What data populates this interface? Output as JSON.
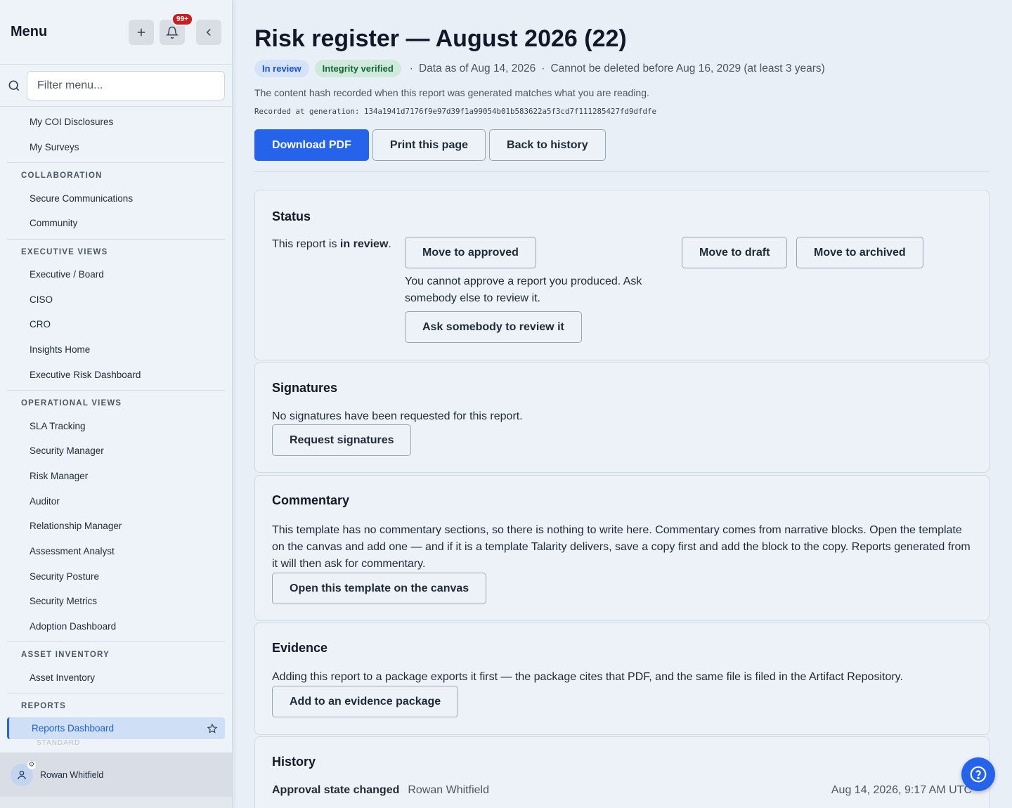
{
  "sidebar": {
    "title": "Menu",
    "notification_badge": "99+",
    "filter_placeholder": "Filter menu...",
    "top_items": [
      "My COI Disclosures",
      "My Surveys"
    ],
    "sections": [
      {
        "title": "COLLABORATION",
        "items": [
          "Secure Communications",
          "Community"
        ]
      },
      {
        "title": "EXECUTIVE VIEWS",
        "items": [
          "Executive / Board",
          "CISO",
          "CRO",
          "Insights Home",
          "Executive Risk Dashboard"
        ]
      },
      {
        "title": "OPERATIONAL VIEWS",
        "items": [
          "SLA Tracking",
          "Security Manager",
          "Risk Manager",
          "Auditor",
          "Relationship Manager",
          "Assessment Analyst",
          "Security Posture",
          "Security Metrics",
          "Adoption Dashboard"
        ]
      },
      {
        "title": "ASSET INVENTORY",
        "items": [
          "Asset Inventory"
        ]
      },
      {
        "title": "REPORTS",
        "items": [
          "Reports Dashboard"
        ]
      }
    ],
    "active_item": "Reports Dashboard",
    "faded_label": "STANDARD",
    "user_name": "Rowan Whitfield"
  },
  "header": {
    "title": "Risk register — August 2026 (22)",
    "status_pill": "In review",
    "integrity_pill": "Integrity verified",
    "data_as_of": "Data as of Aug 14, 2026",
    "retention": "Cannot be deleted before Aug 16, 2029 (at least 3 years)",
    "hash_note": "The content hash recorded when this report was generated matches what you are reading.",
    "hash_line": "Recorded at generation: 134a1941d7176f9e97d39f1a99054b01b583622a5f3cd7f111285427fd9dfdfe",
    "download_label": "Download PDF",
    "print_label": "Print this page",
    "back_label": "Back to history"
  },
  "status_card": {
    "title": "Status",
    "text_prefix": "This report is ",
    "state": "in review",
    "text_suffix": ".",
    "approve_label": "Move to approved",
    "draft_label": "Move to draft",
    "archive_label": "Move to archived",
    "note": "You cannot approve a report you produced. Ask somebody else to review it.",
    "ask_label": "Ask somebody to review it"
  },
  "signatures_card": {
    "title": "Signatures",
    "text": "No signatures have been requested for this report.",
    "button": "Request signatures"
  },
  "commentary_card": {
    "title": "Commentary",
    "text": "This template has no commentary sections, so there is nothing to write here. Commentary comes from narrative blocks. Open the template on the canvas and add one — and if it is a template Talarity delivers, save a copy first and add the block to the copy. Reports generated from it will then ask for commentary.",
    "button": "Open this template on the canvas"
  },
  "evidence_card": {
    "title": "Evidence",
    "text": "Adding this report to a package exports it first — the package cites that PDF, and the same file is filed in the Artifact Repository.",
    "button": "Add to an evidence package"
  },
  "history_card": {
    "title": "History",
    "rows": [
      {
        "event": "Approval state changed",
        "who": "Rowan Whitfield",
        "when": "Aug 14, 2026, 9:17 AM UTC"
      }
    ]
  },
  "colors": {
    "primary": "#2563eb",
    "badge": "#c81e1e",
    "pill_blue": "#d4e3f8",
    "pill_green": "#cfeadc"
  },
  "icons": [
    "plus-icon",
    "bell-icon",
    "chevron-left-icon",
    "search-icon",
    "star-icon",
    "user-icon",
    "gear-icon",
    "help-icon"
  ]
}
